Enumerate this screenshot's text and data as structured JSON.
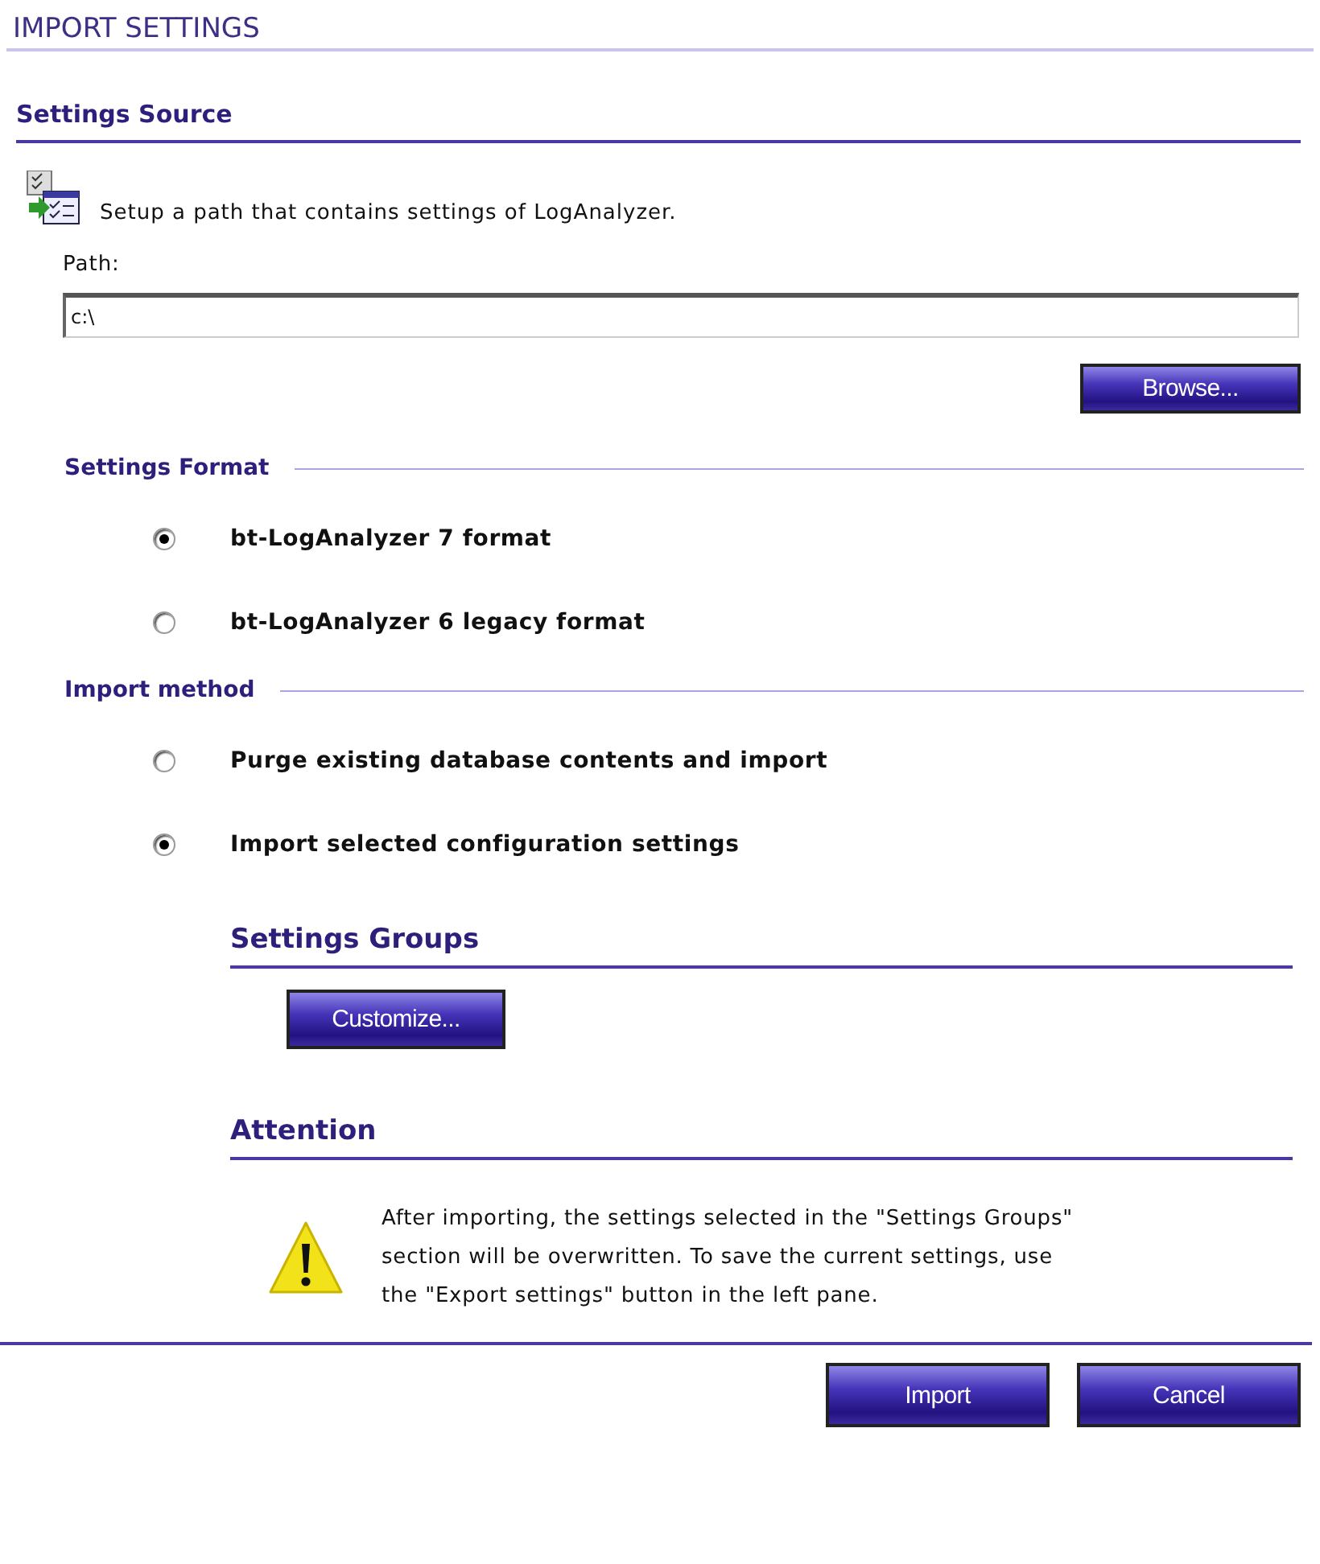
{
  "page_title": "IMPORT SETTINGS",
  "settings_source": {
    "heading": "Settings Source",
    "description": "Setup a path that contains settings of LogAnalyzer.",
    "path_label": "Path:",
    "path_value": "c:\\",
    "browse_button": "Browse..."
  },
  "settings_format": {
    "heading": "Settings Format",
    "options": [
      {
        "label": "bt-LogAnalyzer 7 format",
        "selected": true
      },
      {
        "label": "bt-LogAnalyzer 6 legacy format",
        "selected": false
      }
    ]
  },
  "import_method": {
    "heading": "Import method",
    "options": [
      {
        "label": "Purge existing database contents and import",
        "selected": false
      },
      {
        "label": "Import selected configuration settings",
        "selected": true
      }
    ]
  },
  "settings_groups": {
    "heading": "Settings Groups",
    "button": "Customize..."
  },
  "attention": {
    "heading": "Attention",
    "message": "After importing, the settings selected in the \"Settings Groups\" section will be overwritten. To save the current settings, use the \"Export settings\" button in the left pane."
  },
  "buttons": [
    "Import",
    "Cancel"
  ]
}
